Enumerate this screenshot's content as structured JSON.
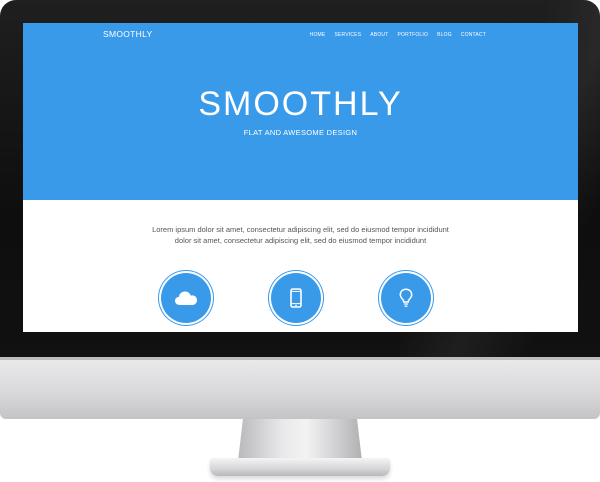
{
  "site": {
    "brand": "SMOOTHLY",
    "nav": [
      {
        "label": "HOME"
      },
      {
        "label": "SERVICES"
      },
      {
        "label": "ABOUT"
      },
      {
        "label": "PORTFOLIO"
      },
      {
        "label": "BLOG"
      },
      {
        "label": "CONTACT"
      }
    ],
    "hero": {
      "title": "SMOOTHLY",
      "subtitle": "FLAT AND AWESOME DESIGN"
    },
    "intro": {
      "line1": "Lorem ipsum dolor sit amet, consectetur adipiscing elit, sed do eiusmod tempor incididunt",
      "line2": "dolor sit amet, consectetur adipiscing elit, sed do eiusmod tempor incididunt"
    },
    "features": [
      {
        "icon": "cloud-icon"
      },
      {
        "icon": "mobile-phone-icon"
      },
      {
        "icon": "lightbulb-icon"
      }
    ]
  },
  "colors": {
    "accent": "#3a9aea",
    "text": "#555555",
    "bezel": "#111111",
    "chin": "#d9d9db"
  }
}
